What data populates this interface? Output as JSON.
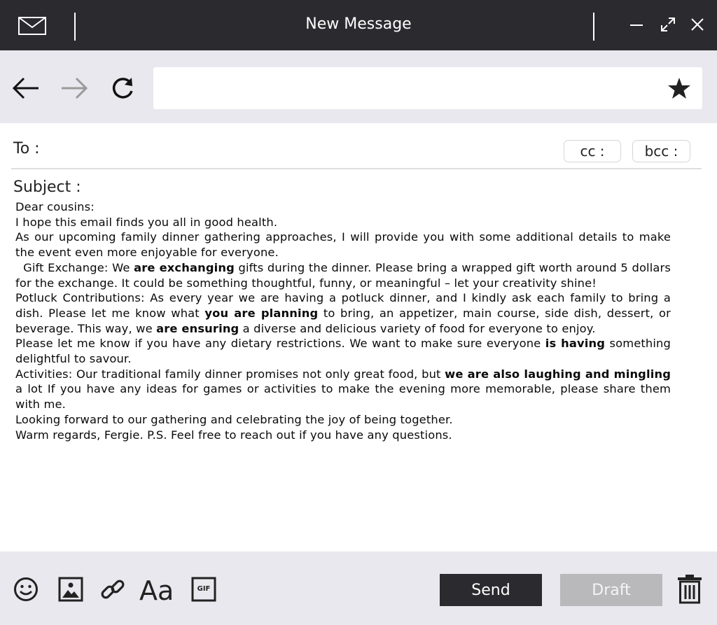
{
  "window": {
    "title": "New Message",
    "icons": [
      "mail-icon",
      "minimize-icon",
      "maximize-icon",
      "close-icon"
    ]
  },
  "navbar": {
    "url_value": "",
    "icons": [
      "back-arrow-icon",
      "forward-arrow-icon",
      "refresh-icon",
      "star-icon"
    ]
  },
  "compose": {
    "to_label": "To :",
    "cc_label": "cc :",
    "bcc_label": "bcc :",
    "subject_label": "Subject :",
    "body": {
      "greeting": "Dear cousins:",
      "line1": "I hope this email finds you all in good health.",
      "line2": "As our upcoming family dinner gathering approaches, I will provide you with some additional details to make the event even more enjoyable for everyone.",
      "gift": {
        "a": "  Gift Exchange: We ",
        "b": "are exchanging",
        "c": " gifts during the dinner. Please bring a wrapped gift worth around 5 dollars for the exchange. It could be something thoughtful, funny, or meaningful – let your creativity shine!"
      },
      "potluck": {
        "a": "Potluck Contributions: As every year we are having a potluck dinner, and I kindly ask each family to bring a dish. Please let me know what ",
        "b": "you are planning",
        "c": " to bring, an appetizer, main course, side dish, dessert, or beverage. This way, we ",
        "d": "are ensuring",
        "e": " a diverse and delicious variety of food for everyone to enjoy."
      },
      "dietary": {
        "a": "Please let me know if you have any dietary restrictions. We want to make sure everyone ",
        "b": "is having",
        "c": " something delightful to savour."
      },
      "activities": {
        "a": "Activities: Our traditional family dinner promises not only great food, but ",
        "b": "we are also laughing and mingling",
        "c": " a lot If you have any ideas for games or activities to make the evening more memorable, please share them with me."
      },
      "closing1": "Looking forward to our gathering and celebrating the joy of being together.",
      "closing2": "Warm regards, Fergie. P.S. Feel free to reach out if you have any questions."
    }
  },
  "footer": {
    "font_label": "Aa",
    "gif_label": "GIF",
    "send_label": "Send",
    "draft_label": "Draft",
    "icons": [
      "emoji-icon",
      "image-icon",
      "link-icon",
      "font-icon",
      "gif-icon",
      "trash-icon"
    ]
  },
  "colors": {
    "titlebar": "#2b2b2f",
    "toolbar_bg": "#e8e8ee",
    "send_bg": "#2b2b2f",
    "draft_bg": "#b9b9bb"
  }
}
